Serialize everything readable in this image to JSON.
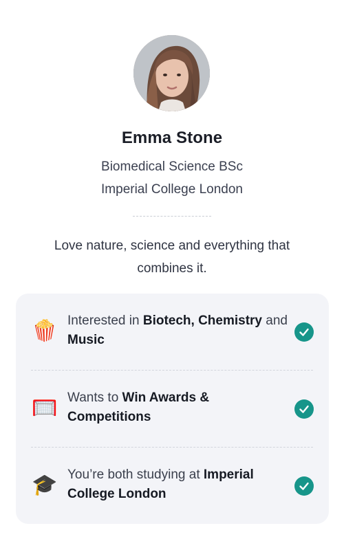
{
  "profile": {
    "name": "Emma Stone",
    "course": "Biomedical Science BSc",
    "university": "Imperial College London",
    "bio": "Love nature, science and everything that combines it."
  },
  "matches": [
    {
      "icon": "popcorn-icon",
      "glyph": "🍿",
      "prefix": "Interested in ",
      "bold1": "Biotech,",
      "mid1": " ",
      "bold2": "Chemistry",
      "mid2": " and ",
      "bold3": "Music"
    },
    {
      "icon": "goal-net-icon",
      "glyph": "🥅",
      "prefix": "Wants to ",
      "bold1": "Win Awards & Competitions"
    },
    {
      "icon": "graduation-cap-icon",
      "glyph": "🎓",
      "prefix": "You’re both studying at ",
      "bold1": "Imperial College London"
    }
  ],
  "colors": {
    "accent": "#17958a",
    "card_bg": "#f3f4f8"
  }
}
